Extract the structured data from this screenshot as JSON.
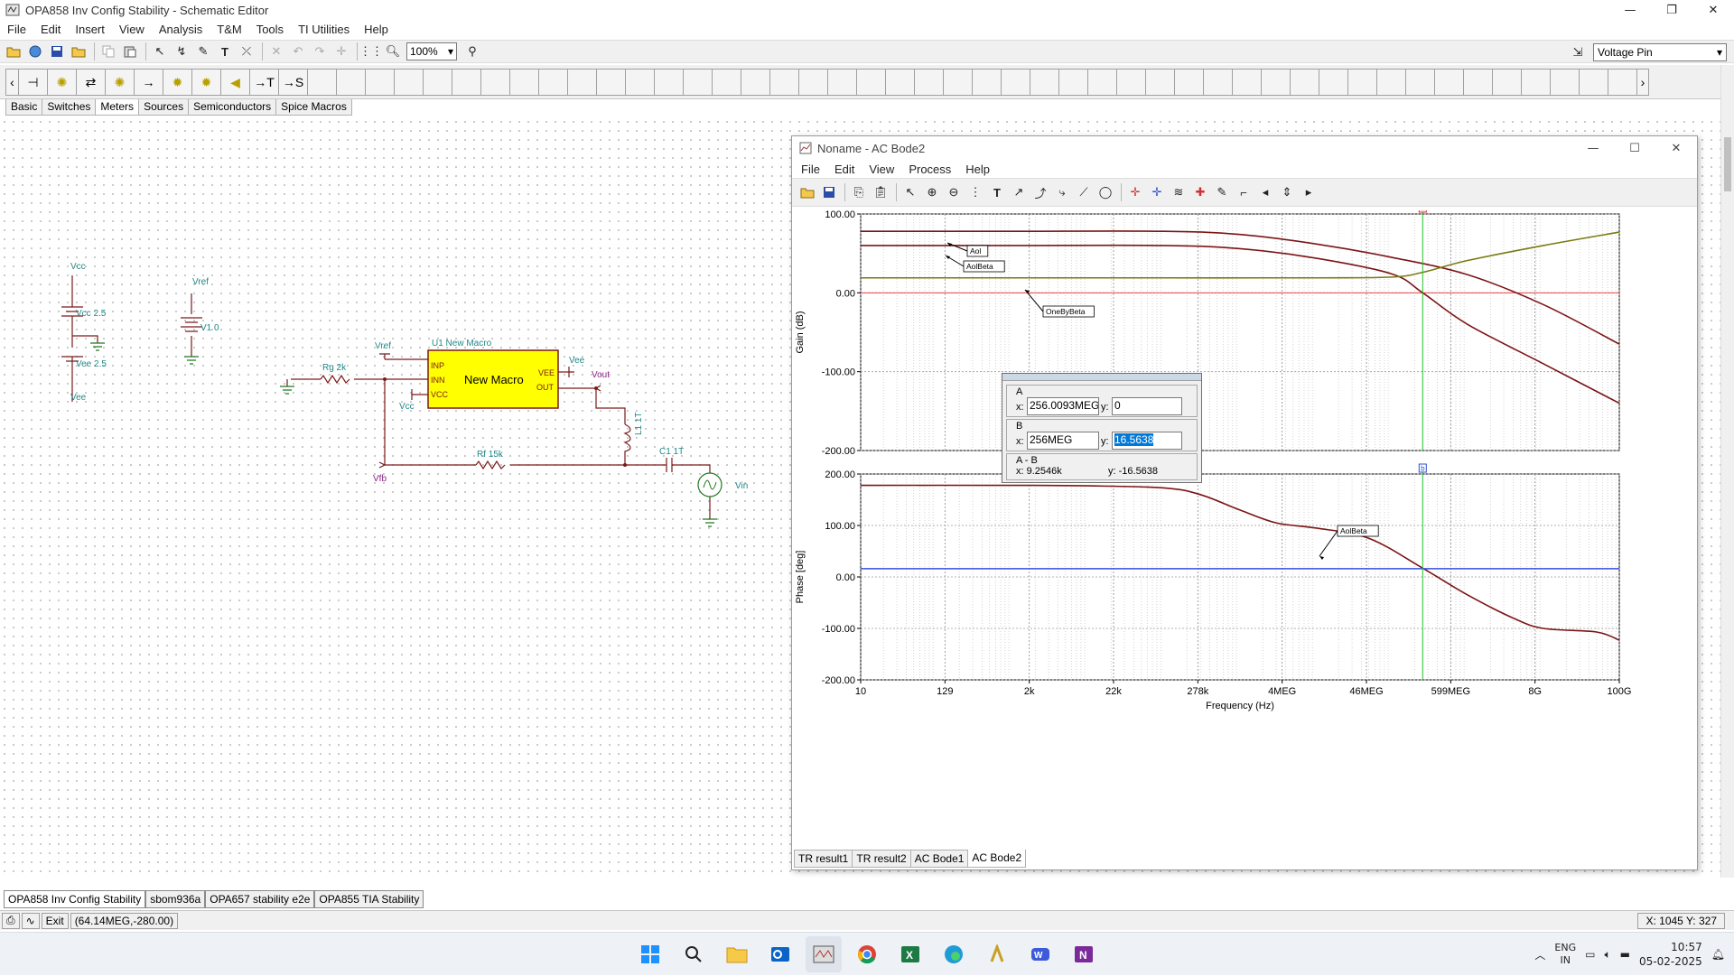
{
  "window": {
    "title": "OPA858 Inv Config Stability - Schematic Editor",
    "minimize": "—",
    "restore": "❐",
    "close": "✕"
  },
  "menu": [
    "File",
    "Edit",
    "Insert",
    "View",
    "Analysis",
    "T&M",
    "Tools",
    "TI Utilities",
    "Help"
  ],
  "toolbar": {
    "zoom": "100%",
    "pin_type": "Voltage Pin"
  },
  "component_tabs": [
    "Basic",
    "Switches",
    "Meters",
    "Sources",
    "Semiconductors",
    "Spice Macros"
  ],
  "active_component_tab": "Meters",
  "schematic": {
    "vcc_label": "Vcc",
    "vcc_src": "Vcc 2.5",
    "vee_src": "Vee 2.5",
    "vee_label": "Vee",
    "vref_label": "Vref",
    "v1": "V1 0",
    "rg": "Rg 2k",
    "rf": "Rf 15k",
    "opamp_title": "U1 New Macro",
    "opamp_body": "New Macro",
    "pin_inp": "INP",
    "pin_inn": "INN",
    "pin_vcc": "VCC",
    "pin_vee": "VEE",
    "pin_out": "OUT",
    "vref_pin": "Vref",
    "vcc_pin": "Vcc",
    "vee_pin": "Vee",
    "vout": "Vout",
    "vfb": "Vfb",
    "l1": "L1 1T",
    "c1": "C1 1T",
    "vin": "Vin"
  },
  "bode": {
    "title": "Noname - AC Bode2",
    "menu": [
      "File",
      "Edit",
      "View",
      "Process",
      "Help"
    ],
    "gain_axis_label": "Gain (dB)",
    "phase_axis_label": "Phase [deg]",
    "x_axis_label": "Frequency (Hz)",
    "gain_ticks": [
      "100.00",
      "0.00",
      "-100.00",
      "-200.00"
    ],
    "phase_ticks": [
      "200.00",
      "100.00",
      "0.00",
      "-100.00",
      "-200.00"
    ],
    "x_ticks": [
      "10",
      "129",
      "2k",
      "22k",
      "278k",
      "4MEG",
      "46MEG",
      "599MEG",
      "8G",
      "100G"
    ],
    "labels": {
      "aol": "Aol",
      "aolbeta": "AolBeta",
      "onebybeta": "OneByBeta",
      "aolbeta_phase": "AolBeta",
      "cursor_a": "a",
      "cursor_b": "b"
    },
    "cursor_panel": {
      "a_label": "A",
      "b_label": "B",
      "diff_label": "A - B",
      "x_label": "x:",
      "y_label": "y:",
      "a_x": "256.0093MEG",
      "a_y": "0",
      "b_x": "256MEG",
      "b_y": "16.5638",
      "diff_x": "x: 9.2546k",
      "diff_y": "y: -16.5638"
    },
    "tabs": [
      "TR result1",
      "TR result2",
      "AC Bode1",
      "AC Bode2"
    ],
    "active_tab": "AC Bode2"
  },
  "chart_data": [
    {
      "type": "line",
      "title": "",
      "xlabel": "Frequency (Hz)",
      "ylabel": "Gain (dB)",
      "xscale": "log",
      "xlim": [
        10,
        100000000000
      ],
      "ylim": [
        -200,
        100
      ],
      "grid": true,
      "series": [
        {
          "name": "Aol",
          "x": [
            10,
            1000,
            100000,
            1000000,
            10000000,
            100000000,
            1000000000,
            10000000000,
            100000000000
          ],
          "y": [
            78,
            78,
            78,
            74,
            62,
            45,
            23,
            -15,
            -65
          ]
        },
        {
          "name": "AolBeta",
          "x": [
            10,
            1000,
            100000,
            1000000,
            10000000,
            100000000,
            256000000,
            1000000000,
            10000000000,
            100000000000
          ],
          "y": [
            60,
            60,
            60,
            56,
            44,
            24,
            0,
            -40,
            -90,
            -140
          ]
        },
        {
          "name": "OneByBeta",
          "x": [
            10,
            1000,
            100000,
            10000000,
            100000000,
            256000000,
            1000000000,
            10000000000,
            100000000000
          ],
          "y": [
            19,
            19,
            19,
            19,
            20,
            26,
            41,
            60,
            77
          ]
        }
      ],
      "cursor_x": 256000000
    },
    {
      "type": "line",
      "title": "",
      "xlabel": "Frequency (Hz)",
      "ylabel": "Phase [deg]",
      "xscale": "log",
      "xlim": [
        10,
        100000000000
      ],
      "ylim": [
        -200,
        200
      ],
      "grid": true,
      "series": [
        {
          "name": "AolBeta",
          "x": [
            10,
            1000,
            10000,
            100000,
            300000,
            1000000,
            3000000,
            10000000,
            50000000,
            256000000,
            1000000000,
            4000000000,
            10000000000,
            50000000000,
            100000000000
          ],
          "y": [
            178,
            178,
            177,
            173,
            160,
            130,
            105,
            95,
            75,
            17,
            -35,
            -80,
            -100,
            -107,
            -123
          ]
        },
        {
          "name": "",
          "x": [
            10,
            100000000000
          ],
          "y": [
            16,
            16
          ]
        }
      ],
      "cursor_x": 256000000
    }
  ],
  "doc_tabs": [
    "OPA858 Inv Config Stability",
    "sbom936a",
    "OPA657 stability e2e",
    "OPA855 TIA Stability"
  ],
  "status": {
    "exit": "Exit",
    "readout": "(64.14MEG,-280.00)",
    "coords": "X: 1045  Y: 327"
  },
  "taskbar": {
    "lang1": "ENG",
    "lang2": "IN",
    "time": "10:57",
    "date": "05-02-2025"
  },
  "colors": {
    "dark_red": "#7b1416",
    "olive": "#7b7a13",
    "cursor": "#22c22a",
    "phase_ref": "#3a4fe0",
    "zero_line": "#ee4444",
    "macro_fill": "#ffff00"
  }
}
